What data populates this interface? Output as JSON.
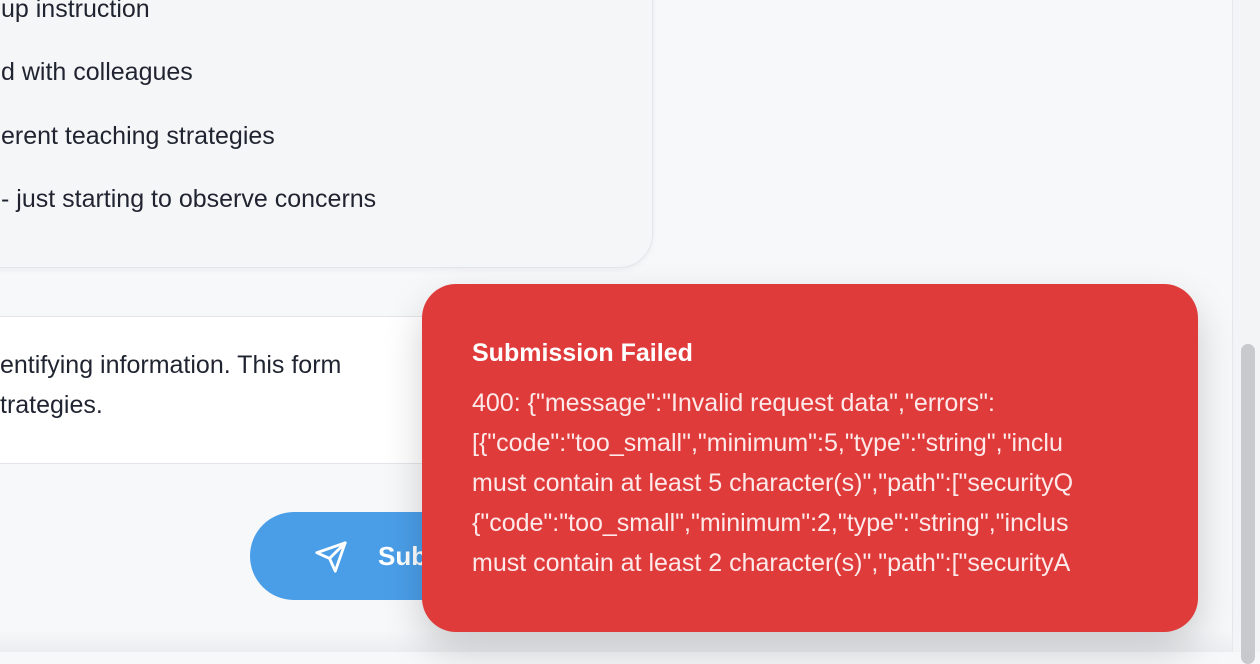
{
  "summary": {
    "lines": [
      "up instruction",
      "d with colleagues",
      "erent teaching strategies",
      "- just starting to observe concerns"
    ]
  },
  "notice": {
    "line1": "entifying information. This form",
    "line2": "trategies."
  },
  "submit": {
    "label": "Sub",
    "icon": "send-icon",
    "color": "#4a9ee8"
  },
  "toast": {
    "title": "Submission Failed",
    "lines": [
      "400: {\"message\":\"Invalid request data\",\"errors\":",
      "[{\"code\":\"too_small\",\"minimum\":5,\"type\":\"string\",\"inclu",
      "must contain at least 5 character(s)\",\"path\":[\"securityQ",
      "{\"code\":\"too_small\",\"minimum\":2,\"type\":\"string\",\"inclus",
      "must contain at least 2 character(s)\",\"path\":[\"securityA"
    ],
    "color": "#e03b3b"
  }
}
